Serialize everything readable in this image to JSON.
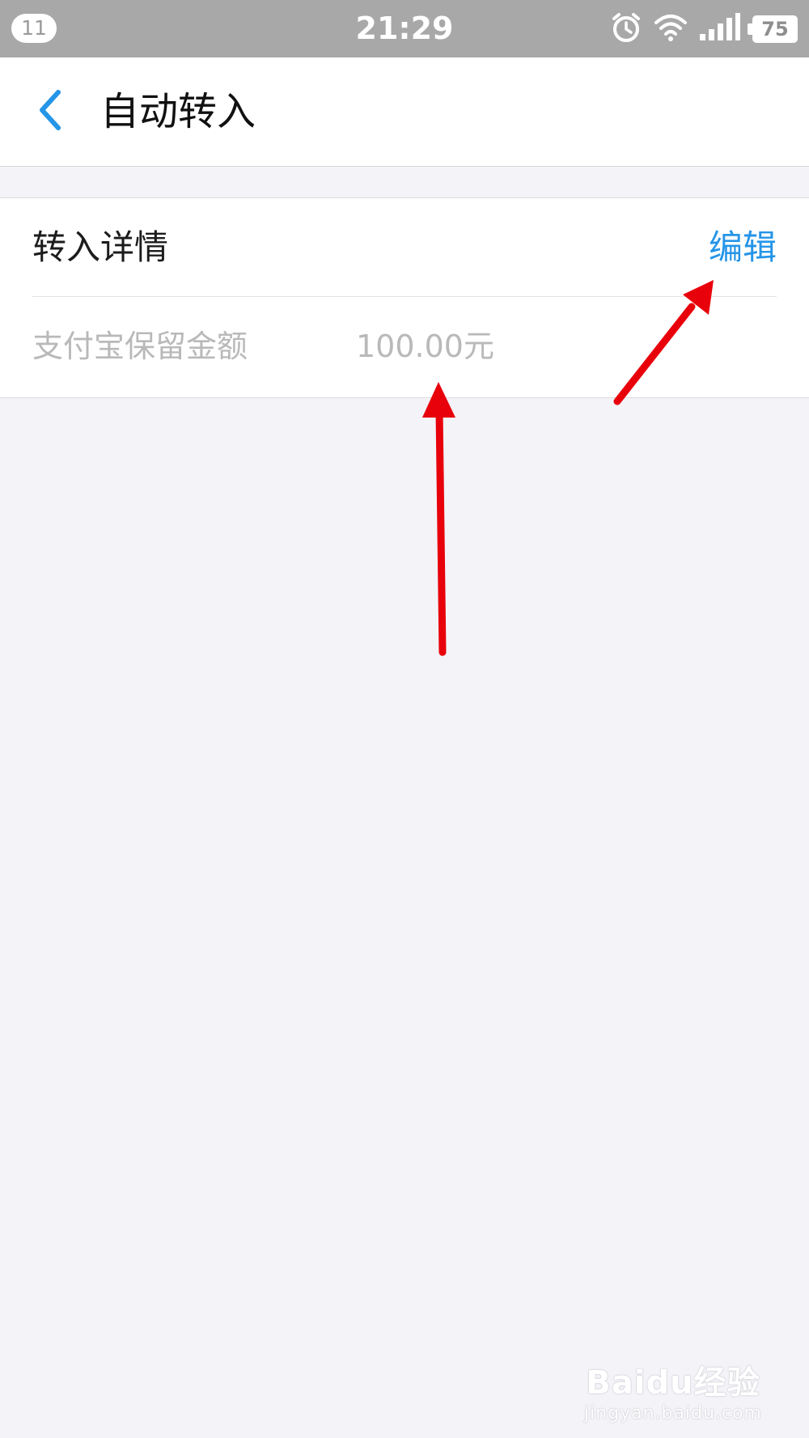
{
  "status_bar": {
    "notification_count": "11",
    "time": "21:29",
    "battery_level": "75",
    "icons": [
      "alarm-icon",
      "wifi-icon",
      "signal-icon",
      "battery-icon"
    ]
  },
  "nav": {
    "title": "自动转入",
    "back_icon": "chevron-left-icon"
  },
  "card": {
    "section_title": "转入详情",
    "edit_label": "编辑",
    "rows": [
      {
        "label": "支付宝保留金额",
        "value": "100.00元"
      }
    ]
  },
  "watermark": {
    "logo": "Baidu经验",
    "url": "jingyan.baidu.com"
  },
  "colors": {
    "accent": "#2595e8",
    "annotation_arrow": "#e8000b",
    "background": "#f3f3f8",
    "status_bar": "#a8a8a8"
  }
}
